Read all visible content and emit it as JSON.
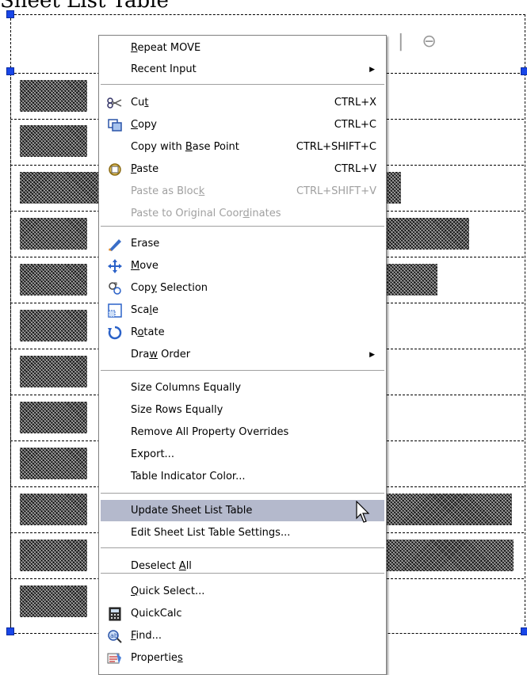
{
  "menu": {
    "items": [
      {
        "label": "Repeat MOVE",
        "accel": "R",
        "shortcut": "",
        "submenu": false,
        "disabled": false,
        "icon": ""
      },
      {
        "label": "Recent Input",
        "accel": "",
        "shortcut": "",
        "submenu": true,
        "disabled": false,
        "icon": ""
      },
      {
        "label": "Cut",
        "accel": "t",
        "shortcut": "CTRL+X",
        "submenu": false,
        "disabled": false,
        "icon": "scissors-icon"
      },
      {
        "label": "Copy",
        "accel": "C",
        "shortcut": "CTRL+C",
        "submenu": false,
        "disabled": false,
        "icon": "copy-icon"
      },
      {
        "label": "Copy with Base Point",
        "accel": "B",
        "shortcut": "CTRL+SHIFT+C",
        "submenu": false,
        "disabled": false,
        "icon": ""
      },
      {
        "label": "Paste",
        "accel": "P",
        "shortcut": "CTRL+V",
        "submenu": false,
        "disabled": false,
        "icon": "paste-icon"
      },
      {
        "label": "Paste as Block",
        "accel": "k",
        "shortcut": "CTRL+SHIFT+V",
        "submenu": false,
        "disabled": true,
        "icon": ""
      },
      {
        "label": "Paste to Original Coordinates",
        "accel": "d",
        "shortcut": "",
        "submenu": false,
        "disabled": true,
        "icon": ""
      },
      {
        "label": "Erase",
        "accel": "",
        "shortcut": "",
        "submenu": false,
        "disabled": false,
        "icon": "erase-icon"
      },
      {
        "label": "Move",
        "accel": "M",
        "shortcut": "",
        "submenu": false,
        "disabled": false,
        "icon": "move-icon"
      },
      {
        "label": "Copy Selection",
        "accel": "y",
        "shortcut": "",
        "submenu": false,
        "disabled": false,
        "icon": "copy-selection-icon"
      },
      {
        "label": "Scale",
        "accel": "l",
        "shortcut": "",
        "submenu": false,
        "disabled": false,
        "icon": "scale-icon"
      },
      {
        "label": "Rotate",
        "accel": "o",
        "shortcut": "",
        "submenu": false,
        "disabled": false,
        "icon": "rotate-icon"
      },
      {
        "label": "Draw Order",
        "accel": "w",
        "shortcut": "",
        "submenu": true,
        "disabled": false,
        "icon": ""
      },
      {
        "label": "Size Columns Equally",
        "accel": "",
        "shortcut": "",
        "submenu": false,
        "disabled": false,
        "icon": ""
      },
      {
        "label": "Size Rows Equally",
        "accel": "",
        "shortcut": "",
        "submenu": false,
        "disabled": false,
        "icon": ""
      },
      {
        "label": "Remove All Property Overrides",
        "accel": "",
        "shortcut": "",
        "submenu": false,
        "disabled": false,
        "icon": ""
      },
      {
        "label": "Export...",
        "accel": "",
        "shortcut": "",
        "submenu": false,
        "disabled": false,
        "icon": ""
      },
      {
        "label": "Table Indicator Color...",
        "accel": "",
        "shortcut": "",
        "submenu": false,
        "disabled": false,
        "icon": ""
      },
      {
        "label": "Update Sheet List Table",
        "accel": "",
        "shortcut": "",
        "submenu": false,
        "disabled": false,
        "icon": "",
        "highlighted": true
      },
      {
        "label": "Edit Sheet List Table Settings...",
        "accel": "",
        "shortcut": "",
        "submenu": false,
        "disabled": false,
        "icon": ""
      },
      {
        "label": "Deselect All",
        "accel": "A",
        "shortcut": "",
        "submenu": false,
        "disabled": false,
        "icon": ""
      },
      {
        "label": "Quick Select...",
        "accel": "Q",
        "shortcut": "",
        "submenu": false,
        "disabled": false,
        "icon": ""
      },
      {
        "label": "QuickCalc",
        "accel": "",
        "shortcut": "",
        "submenu": false,
        "disabled": false,
        "icon": "calculator-icon"
      },
      {
        "label": "Find...",
        "accel": "F",
        "shortcut": "",
        "submenu": false,
        "disabled": false,
        "icon": "find-icon"
      },
      {
        "label": "Properties",
        "accel": "s",
        "shortcut": "",
        "submenu": false,
        "disabled": false,
        "icon": "properties-icon"
      }
    ]
  },
  "background": {
    "title": "Sheet List Table",
    "colors": {
      "highlight": "#b4b9cc",
      "grip": "#1846e8",
      "disabled": "#a0a0a0"
    }
  }
}
